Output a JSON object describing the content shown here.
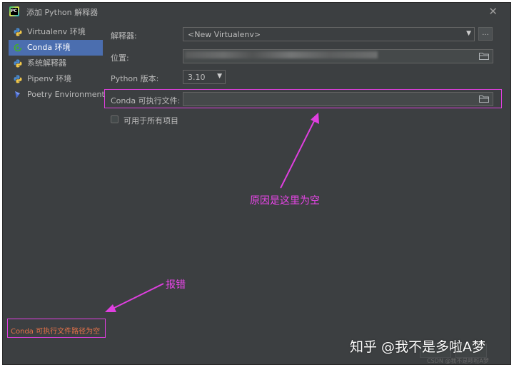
{
  "window": {
    "title": "添加 Python 解释器",
    "close_label": "✕"
  },
  "sidebar": {
    "items": [
      {
        "label": "Virtualenv 环境",
        "icon": "python-icon"
      },
      {
        "label": "Conda 环境",
        "icon": "conda-icon",
        "selected": true
      },
      {
        "label": "系统解释器",
        "icon": "python-icon"
      },
      {
        "label": "Pipenv 环境",
        "icon": "python-icon"
      },
      {
        "label": "Poetry Environment",
        "icon": "python-icon"
      }
    ]
  },
  "form": {
    "interpreter_label": "解释器:",
    "interpreter_value": "<New Virtualenv>",
    "more_button": "...",
    "location_label": "位置:",
    "python_version_label": "Python 版本:",
    "python_version_value": "3.10",
    "conda_exec_label": "Conda 可执行文件:",
    "conda_exec_value": "",
    "all_projects_label": "可用于所有项目"
  },
  "annotations": {
    "cause": "原因是这里为空",
    "error_pointer": "报错"
  },
  "error_message": "Conda 可执行文件路径为空",
  "watermark": {
    "main": "知乎 @我不是多啦A梦",
    "small": "CSDN @我不是哆啦A梦"
  },
  "colors": {
    "dialog_bg": "#3c3f41",
    "selection": "#4b6eaf",
    "annotation": "#e03fe0",
    "error_text": "#e8734a"
  }
}
